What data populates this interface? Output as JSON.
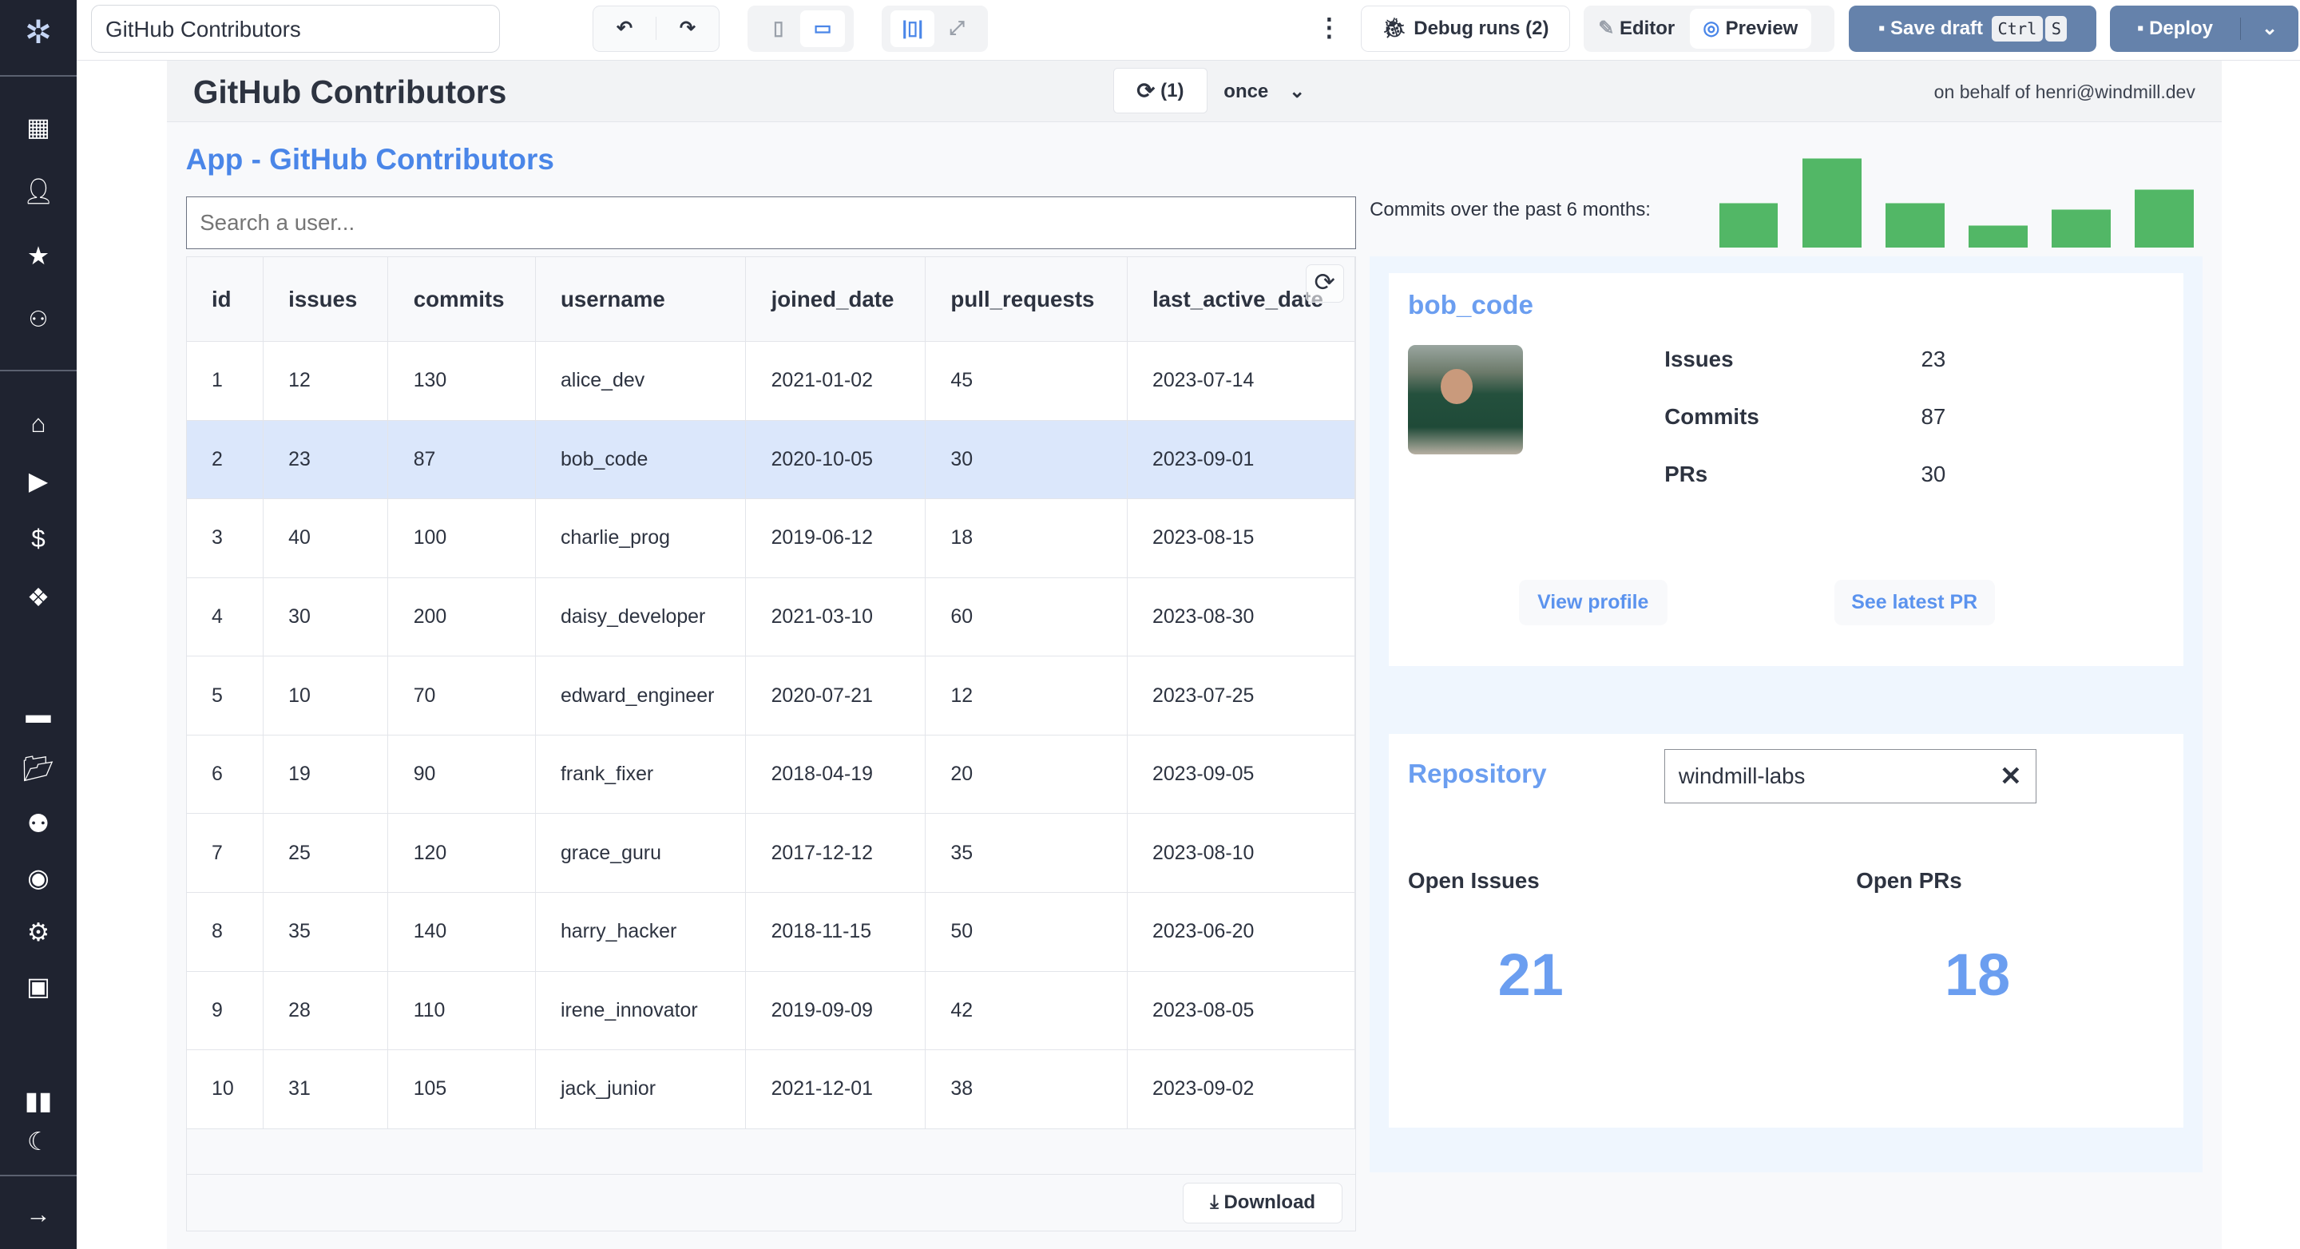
{
  "topbar": {
    "app_name": "GitHub Contributors",
    "debug_runs": "Debug runs (2)",
    "editor": "Editor",
    "preview": "Preview",
    "save_draft": "Save draft",
    "kbd_ctrl": "Ctrl",
    "kbd_s": "S",
    "deploy": "Deploy"
  },
  "app_header": {
    "title": "GitHub Contributors",
    "refresh_count": "(1)",
    "refresh_mode": "once",
    "on_behalf": "on behalf of henri@windmill.dev"
  },
  "app": {
    "heading": "App - GitHub Contributors",
    "search_placeholder": "Search a user...",
    "download": "Download"
  },
  "table": {
    "columns": [
      "id",
      "issues",
      "commits",
      "username",
      "joined_date",
      "pull_requests",
      "last_active_date"
    ],
    "selected_index": 1,
    "rows": [
      [
        "1",
        "12",
        "130",
        "alice_dev",
        "2021-01-02",
        "45",
        "2023-07-14"
      ],
      [
        "2",
        "23",
        "87",
        "bob_code",
        "2020-10-05",
        "30",
        "2023-09-01"
      ],
      [
        "3",
        "40",
        "100",
        "charlie_prog",
        "2019-06-12",
        "18",
        "2023-08-15"
      ],
      [
        "4",
        "30",
        "200",
        "daisy_developer",
        "2021-03-10",
        "60",
        "2023-08-30"
      ],
      [
        "5",
        "10",
        "70",
        "edward_engineer",
        "2020-07-21",
        "12",
        "2023-07-25"
      ],
      [
        "6",
        "19",
        "90",
        "frank_fixer",
        "2018-04-19",
        "20",
        "2023-09-05"
      ],
      [
        "7",
        "25",
        "120",
        "grace_guru",
        "2017-12-12",
        "35",
        "2023-08-10"
      ],
      [
        "8",
        "35",
        "140",
        "harry_hacker",
        "2018-11-15",
        "50",
        "2023-06-20"
      ],
      [
        "9",
        "28",
        "110",
        "irene_innovator",
        "2019-09-09",
        "42",
        "2023-08-05"
      ],
      [
        "10",
        "31",
        "105",
        "jack_junior",
        "2021-12-01",
        "38",
        "2023-09-02"
      ]
    ]
  },
  "chart_label": "Commits over the past 6 months:",
  "chart_data": {
    "type": "bar",
    "values": [
      20,
      40,
      20,
      10,
      17,
      26
    ],
    "color": "#52b766",
    "axes": "hidden",
    "grid": false
  },
  "profile": {
    "username": "bob_code",
    "stats": [
      {
        "label": "Issues",
        "value": "23"
      },
      {
        "label": "Commits",
        "value": "87"
      },
      {
        "label": "PRs",
        "value": "30"
      }
    ],
    "view_profile": "View profile",
    "latest_pr": "See latest PR"
  },
  "repo": {
    "label": "Repository",
    "value": "windmill-labs",
    "open_issues_label": "Open Issues",
    "open_issues": "21",
    "open_prs_label": "Open PRs",
    "open_prs": "18"
  },
  "colors": {
    "accent": "#6b9ef0",
    "sidebar": "#1f2330",
    "deploy": "#6582ab",
    "selected_row": "#dbe7fb"
  }
}
